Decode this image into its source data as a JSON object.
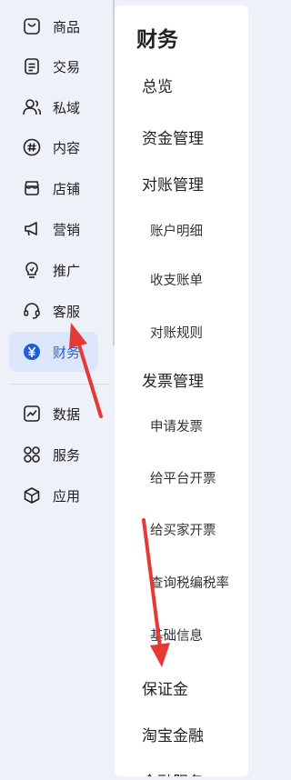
{
  "sidebar": {
    "items": [
      {
        "label": "商品",
        "icon": "bag-icon"
      },
      {
        "label": "交易",
        "icon": "document-icon"
      },
      {
        "label": "私域",
        "icon": "users-icon"
      },
      {
        "label": "内容",
        "icon": "hashtag-icon"
      },
      {
        "label": "店铺",
        "icon": "store-icon"
      },
      {
        "label": "营销",
        "icon": "megaphone-icon"
      },
      {
        "label": "推广",
        "icon": "bulb-icon"
      },
      {
        "label": "客服",
        "icon": "headset-icon"
      },
      {
        "label": "财务",
        "icon": "yen-icon"
      },
      {
        "label": "数据",
        "icon": "chart-icon"
      },
      {
        "label": "服务",
        "icon": "grid-icon"
      },
      {
        "label": "应用",
        "icon": "cube-icon"
      }
    ],
    "active_index": 8
  },
  "panel": {
    "title": "财务",
    "menu": [
      {
        "label": "总览"
      },
      {
        "label": "资金管理"
      },
      {
        "label": "对账管理"
      },
      {
        "label": "账户明细",
        "sub": true
      },
      {
        "label": "收支账单",
        "sub": true
      },
      {
        "label": "对账规则",
        "sub": true
      },
      {
        "label": "发票管理"
      },
      {
        "label": "申请发票",
        "sub": true
      },
      {
        "label": "给平台开票",
        "sub": true
      },
      {
        "label": "给买家开票",
        "sub": true
      },
      {
        "label": "查询税编税率",
        "sub": true
      },
      {
        "label": "基础信息",
        "sub": true
      },
      {
        "label": "保证金"
      },
      {
        "label": "淘宝金融"
      },
      {
        "label": "金融服务"
      }
    ]
  },
  "colors": {
    "accent": "#1f5fd6",
    "annotation": "#e53935"
  }
}
